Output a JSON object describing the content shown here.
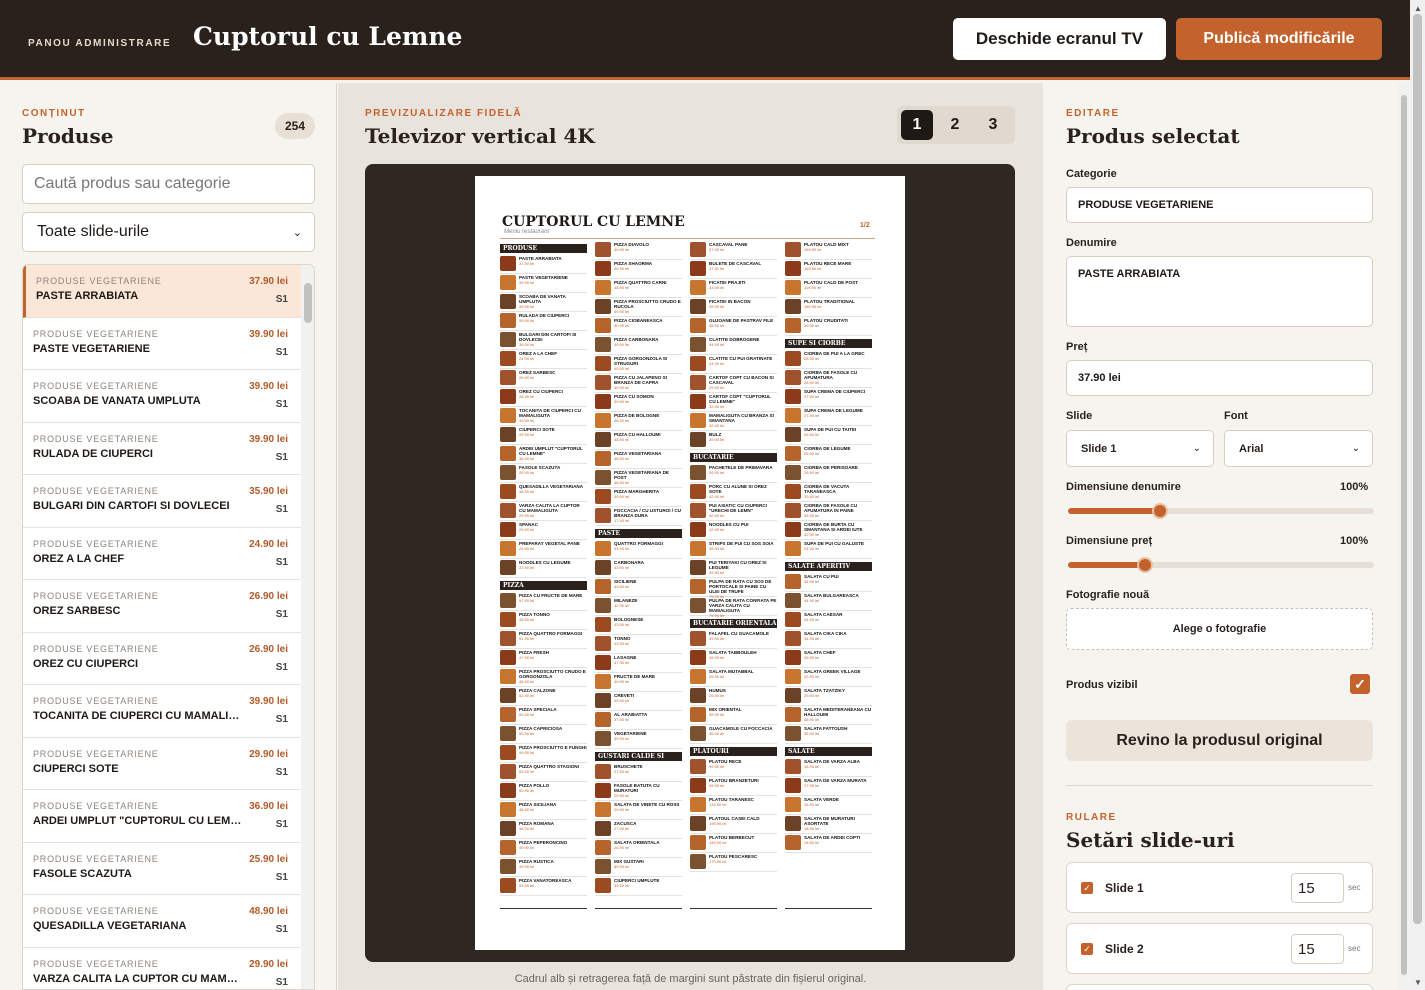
{
  "topbar": {
    "kicker": "PANOU ADMINISTRARE",
    "title": "Cuptorul cu Lemne",
    "tv_button": "Deschide ecranul TV",
    "publish_button": "Publică modificările"
  },
  "left": {
    "kicker": "CONȚINUT",
    "title": "Produse",
    "count": "254",
    "search_placeholder": "Caută produs sau categorie",
    "slide_filter": "Toate slide-urile",
    "items": [
      {
        "cat": "PRODUSE VEGETARIENE",
        "name": "PASTE ARRABIATA",
        "price": "37.90 lei",
        "slide": "S1",
        "active": true
      },
      {
        "cat": "PRODUSE VEGETARIENE",
        "name": "PASTE VEGETARIENE",
        "price": "39.90 lei",
        "slide": "S1"
      },
      {
        "cat": "PRODUSE VEGETARIENE",
        "name": "SCOABA DE VANATA UMPLUTA",
        "price": "39.90 lei",
        "slide": "S1"
      },
      {
        "cat": "PRODUSE VEGETARIENE",
        "name": "RULADA DE CIUPERCI",
        "price": "39.90 lei",
        "slide": "S1"
      },
      {
        "cat": "PRODUSE VEGETARIENE",
        "name": "BULGARI DIN CARTOFI SI DOVLECEI",
        "price": "35.90 lei",
        "slide": "S1"
      },
      {
        "cat": "PRODUSE VEGETARIENE",
        "name": "OREZ A LA CHEF",
        "price": "24.90 lei",
        "slide": "S1"
      },
      {
        "cat": "PRODUSE VEGETARIENE",
        "name": "OREZ SARBESC",
        "price": "26.90 lei",
        "slide": "S1"
      },
      {
        "cat": "PRODUSE VEGETARIENE",
        "name": "OREZ CU CIUPERCI",
        "price": "26.90 lei",
        "slide": "S1"
      },
      {
        "cat": "PRODUSE VEGETARIENE",
        "name": "TOCANITA DE CIUPERCI CU MAMALIGUTA",
        "price": "39.90 lei",
        "slide": "S1"
      },
      {
        "cat": "PRODUSE VEGETARIENE",
        "name": "CIUPERCI SOTE",
        "price": "29.90 lei",
        "slide": "S1"
      },
      {
        "cat": "PRODUSE VEGETARIENE",
        "name": "ARDEI UMPLUT \"CUPTORUL CU LEMNE\"",
        "price": "36.90 lei",
        "slide": "S1"
      },
      {
        "cat": "PRODUSE VEGETARIENE",
        "name": "FASOLE SCAZUTA",
        "price": "25.90 lei",
        "slide": "S1"
      },
      {
        "cat": "PRODUSE VEGETARIENE",
        "name": "QUESADILLA VEGETARIANA",
        "price": "48.90 lei",
        "slide": "S1"
      },
      {
        "cat": "PRODUSE VEGETARIENE",
        "name": "VARZA CALITA LA CUPTOR CU MAMALIGUTA",
        "price": "29.90 lei",
        "slide": "S1"
      }
    ]
  },
  "center": {
    "kicker": "PREVIZUALIZARE FIDELĂ",
    "title": "Televizor vertical 4K",
    "pages": [
      "1",
      "2",
      "3"
    ],
    "caption": "Cadrul alb și retragerea față de margini sunt păstrate din fișierul original.",
    "menu": {
      "title": "CUPTORUL CU LEMNE",
      "subtitle": "Meniu restaurant",
      "page": "1/2",
      "columns": [
        [
          {
            "type": "cat",
            "text": "PRODUSE VEGETARIENE"
          },
          {
            "n": "PASTE ARRABIATA",
            "p": "37.90 lei"
          },
          {
            "n": "PASTE VEGETARIENE",
            "p": "39.90 lei"
          },
          {
            "n": "SCOABA DE VANATA UMPLUTA",
            "p": "39.90 lei"
          },
          {
            "n": "RULADA DE CIUPERCI",
            "p": "39.90 lei"
          },
          {
            "n": "BULGARI DIN CARTOFI SI DOVLECEI",
            "p": "35.90 lei"
          },
          {
            "n": "OREZ A LA CHEF",
            "p": "24.90 lei"
          },
          {
            "n": "OREZ SARBESC",
            "p": "26.90 lei"
          },
          {
            "n": "OREZ CU CIUPERCI",
            "p": "26.90 lei"
          },
          {
            "n": "TOCANITA DE CIUPERCI CU MAMALIGUTA",
            "p": "39.90 lei"
          },
          {
            "n": "CIUPERCI SOTE",
            "p": "29.90 lei"
          },
          {
            "n": "ARDEI UMPLUT \"CUPTORUL CU LEMNE\"",
            "p": "36.90 lei"
          },
          {
            "n": "FASOLE SCAZUTA",
            "p": "25.90 lei"
          },
          {
            "n": "QUESADILLA VEGETARIANA",
            "p": "48.90 lei"
          },
          {
            "n": "VARZA CALITA LA CUPTOR CU MAMALIGUTA",
            "p": "29.90 lei"
          },
          {
            "n": "SPANAC",
            "p": "29.90 lei"
          },
          {
            "n": "PREPARAT VEGETAL PANE",
            "p": "29.90 lei"
          },
          {
            "n": "NOODLES CU LEGUME",
            "p": "37.90 lei"
          },
          {
            "type": "cat",
            "text": "PIZZA"
          },
          {
            "n": "PIZZA CU FRUCTE DE MARE",
            "p": "57.90 lei"
          },
          {
            "n": "PIZZA TONNO",
            "p": "48.90 lei"
          },
          {
            "n": "PIZZA QUATTRO FORMAGGI",
            "p": "51.90 lei"
          },
          {
            "n": "PIZZA FRESH",
            "p": "47.90 lei"
          },
          {
            "n": "PIZZA PROSCIUTTO CRUDO E GORGONZOLA",
            "p": "48.90 lei"
          },
          {
            "n": "PIZZA CALZONE",
            "p": "52.90 lei"
          },
          {
            "n": "PIZZA SPECIALA",
            "p": "52.90 lei"
          },
          {
            "n": "PIZZA CAPRICIOSA",
            "p": "50.90 lei"
          },
          {
            "n": "PIZZA PROSCIUTTO E FUNGHI",
            "p": "49.90 lei"
          },
          {
            "n": "PIZZA QUATTRO STAGIONI",
            "p": "53.90 lei"
          },
          {
            "n": "PIZZA POLLO",
            "p": "50.90 lei"
          },
          {
            "n": "PIZZA SICILIANA",
            "p": "48.90 lei"
          },
          {
            "n": "PIZZA ROMANA",
            "p": "48.90 lei"
          },
          {
            "n": "PIZZA PEPERONCINO",
            "p": "49.90 lei"
          },
          {
            "n": "PIZZA RUSTICA",
            "p": "49.90 lei"
          },
          {
            "n": "PIZZA VANATOREASCA",
            "p": "53.90 lei"
          }
        ],
        [
          {
            "n": "PIZZA DIAVOLO",
            "p": "49.90 lei"
          },
          {
            "n": "PIZZA SHAORMA",
            "p": "49.90 lei"
          },
          {
            "n": "PIZZA QUATTRO CARNI",
            "p": "48.90 lei"
          },
          {
            "n": "PIZZA PROSCIUTTO CRUDO E RUCOLA",
            "p": "49.90 lei"
          },
          {
            "n": "PIZZA CIOBANEASCA",
            "p": "50.90 lei"
          },
          {
            "n": "PIZZA CARBONARA",
            "p": "49.90 lei"
          },
          {
            "n": "PIZZA GORGONZOLA SI STRUGURI",
            "p": "49.90 lei"
          },
          {
            "n": "PIZZA CU JALAPENO SI BRANZA DE CAPRA",
            "p": "49.90 lei"
          },
          {
            "n": "PIZZA CU SOMON",
            "p": "59.90 lei"
          },
          {
            "n": "PIZZA DE BOLOGNE",
            "p": "48.90 lei"
          },
          {
            "n": "PIZZA CU HALLOUMI",
            "p": "48.90 lei"
          },
          {
            "n": "PIZZA VEGETARIANA",
            "p": "48.90 lei"
          },
          {
            "n": "PIZZA VEGETARIANA DE POST",
            "p": "48.90 lei"
          },
          {
            "n": "PIZZA MARGHERITA",
            "p": "39.90 lei"
          },
          {
            "n": "FOCCACIA / CU USTUROI / CU BRANZA DURA",
            "p": "17.90 lei"
          },
          {
            "type": "cat",
            "text": "PASTE"
          },
          {
            "n": "QUATTRO FORMAGGI",
            "p": "43.90 lei"
          },
          {
            "n": "CARBONARA",
            "p": "43.90 lei"
          },
          {
            "n": "SICILIENE",
            "p": "43.90 lei"
          },
          {
            "n": "MILANEZE",
            "p": "42.90 lei"
          },
          {
            "n": "BOLOGNESE",
            "p": "43.90 lei"
          },
          {
            "n": "TONNO",
            "p": "43.90 lei"
          },
          {
            "n": "LASAGNE",
            "p": "47.90 lei"
          },
          {
            "n": "FRUCTE DE MARE",
            "p": "49.90 lei"
          },
          {
            "n": "CREVETI",
            "p": "49.90 lei"
          },
          {
            "n": "AL ARABIATTA",
            "p": "37.90 lei"
          },
          {
            "n": "VEGETARIENE",
            "p": "39.90 lei"
          },
          {
            "type": "cat",
            "text": "GUSTARI CALDE SI RECI"
          },
          {
            "n": "BRUSCHETE",
            "p": "27.90 lei"
          },
          {
            "n": "FASOLE BATUTA CU MURATURI",
            "p": "29.90 lei"
          },
          {
            "n": "SALATA DE VINETE CU ROSII",
            "p": "29.90 lei"
          },
          {
            "n": "ZACUSCA",
            "p": "27.90 lei"
          },
          {
            "n": "SALATA ORIENTALA",
            "p": "26.90 lei"
          },
          {
            "n": "MIX GUSTARI",
            "p": "89.90 lei"
          },
          {
            "n": "CIUPERCI UMPLUTE",
            "p": "39.90 lei"
          }
        ],
        [
          {
            "n": "CASCAVAL PANE",
            "p": "37.90 lei"
          },
          {
            "n": "BULETE DE CASCAVAL",
            "p": "37.90 lei"
          },
          {
            "n": "FICATEI PRAJITI",
            "p": "33.90 lei"
          },
          {
            "n": "FICATEI IN BACON",
            "p": "39.90 lei"
          },
          {
            "n": "GUJOANE DE PASTRAV FILE",
            "p": "46.90 lei"
          },
          {
            "n": "CLATITE DOBROGENE",
            "p": "44.90 lei"
          },
          {
            "n": "CLATITE CU PUI GRATINATE",
            "p": "44.90 lei"
          },
          {
            "n": "CARTOF COPT CU BACON SI CASCAVAL",
            "p": "29.90 lei"
          },
          {
            "n": "CARTOF COPT \"CUPTORUL CU LEMNE\"",
            "p": "32.90 lei"
          },
          {
            "n": "MAMALIGUTA CU BRANZA SI SMANTANA",
            "p": "32.90 lei"
          },
          {
            "n": "BULZ",
            "p": "39.90 lei"
          },
          {
            "type": "cat",
            "text": "BUCATARIE INTERNATIONALA"
          },
          {
            "n": "PACHETELE DE PRIMAVARA",
            "p": "26.90 lei"
          },
          {
            "n": "PORC CU ALUNE SI OREZ SOTE",
            "p": "42.90 lei"
          },
          {
            "n": "PUI ASIATIC CU CIUPERCI \"URECHI DE LEMN\"",
            "p": "42.90 lei"
          },
          {
            "n": "NOODLES CU PUI",
            "p": "42.90 lei"
          },
          {
            "n": "STRIPS DE PUI CU SOS SOIA",
            "p": "39.90 lei"
          },
          {
            "n": "PUI TERIYAKI CU OREZ SI LEGUME",
            "p": "49.90 lei"
          },
          {
            "n": "PULPA DE RATA CU SOS DE PORTOCALE SI PAINE CU ULEI DE TRUFE",
            "p": "79.90 lei"
          },
          {
            "n": "PULPA DE RATA CONFIATA PE VARZA CALITA CU MAMALIGUTA",
            "p": "79.90 lei"
          },
          {
            "type": "cat",
            "text": "BUCATARIE ORIENTALA"
          },
          {
            "n": "FALAFEL CU GUACAMOLE",
            "p": "39.90 lei"
          },
          {
            "n": "SALATA TABBOULEH",
            "p": "26.90 lei"
          },
          {
            "n": "SALATA MUTABBAL",
            "p": "25.90 lei"
          },
          {
            "n": "HUMUS",
            "p": "25.90 lei"
          },
          {
            "n": "MIX ORIENTAL",
            "p": "59.90 lei"
          },
          {
            "n": "GUACAMOLE CU FOCCACIA",
            "p": "36.90 lei"
          },
          {
            "type": "cat",
            "text": "PLATOURI"
          },
          {
            "n": "PLATOU RECE",
            "p": "99.90 lei"
          },
          {
            "n": "PLATOU BRANZETURI",
            "p": "99.90 lei"
          },
          {
            "n": "PLATOU TARANESC",
            "p": "134.90 lei"
          },
          {
            "n": "PLATOUL CASEI CALD",
            "p": "199.90 lei"
          },
          {
            "n": "PLATOU BERBECUT",
            "p": "149.90 lei"
          },
          {
            "n": "PLATOU PESCARESC",
            "p": "179.90 lei"
          }
        ],
        [
          {
            "n": "PLATOU CALD MIXT",
            "p": "169.90 lei"
          },
          {
            "n": "PLATOU RECE MARE",
            "p": "169.90 lei"
          },
          {
            "n": "PLATOU CALD DE POST",
            "p": "119.90 lei"
          },
          {
            "n": "PLATOU TRADITIONAL",
            "p": "189.90 lei"
          },
          {
            "n": "PLATOU CRUDITATI",
            "p": "39.90 lei"
          },
          {
            "type": "cat",
            "text": "SUPE SI CIORBE"
          },
          {
            "n": "CIORBA DE PUI A LA GREC",
            "p": "28.90 lei"
          },
          {
            "n": "CIORBA DE FASOLE CU AFUMATURA",
            "p": "28.90 lei"
          },
          {
            "n": "SUPA CREMA DE CIUPERCI",
            "p": "27.90 lei"
          },
          {
            "n": "SUPA CREMA DE LEGUME",
            "p": "27.90 lei"
          },
          {
            "n": "SUPA DE PUI CU TAITEI",
            "p": "26.90 lei"
          },
          {
            "n": "CIORBA DE LEGUME",
            "p": "26.90 lei"
          },
          {
            "n": "CIORBA DE PERISOARE",
            "p": "28.90 lei"
          },
          {
            "n": "CIORBA DE VACUTA TARANEASCA",
            "p": "29.90 lei"
          },
          {
            "n": "CIORBA DE FASOLE CU AFUMATURA IN PAINE",
            "p": "35.90 lei"
          },
          {
            "n": "CIORBA DE BURTA CU SMANTANA SI ARDEI IUTE",
            "p": "32.90 lei"
          },
          {
            "n": "SUPA DE PUI CU GALUSTE",
            "p": "24.90 lei"
          },
          {
            "type": "cat",
            "text": "SALATE APERITIV"
          },
          {
            "n": "SALATA CU PUI",
            "p": "34.90 lei"
          },
          {
            "n": "SALATA BULGAREASCA",
            "p": "44.90 lei"
          },
          {
            "n": "SALATA CAESAR",
            "p": "44.90 lei"
          },
          {
            "n": "SALATA CIKA CIKA",
            "p": "34.90 lei"
          },
          {
            "n": "SALATA CHEF",
            "p": "45.90 lei"
          },
          {
            "n": "SALATA GREEK VILLAGE",
            "p": "42.90 lei"
          },
          {
            "n": "SALATA TZATZIKY",
            "p": "29.90 lei"
          },
          {
            "n": "SALATA MEDITERANEANA CU HALLOUMI",
            "p": "48.90 lei"
          },
          {
            "n": "SALATA FATTOUSH",
            "p": "35.90 lei"
          },
          {
            "type": "cat",
            "text": "SALATE"
          },
          {
            "n": "SALATA DE VARZA ALBA",
            "p": "15.90 lei"
          },
          {
            "n": "SALATA DE VARZA MURATA",
            "p": "17.90 lei"
          },
          {
            "n": "SALATA VERDE",
            "p": "15.90 lei"
          },
          {
            "n": "SALATA DE MURATURI ASORTATE",
            "p": "18.90 lei"
          },
          {
            "n": "SALATA DE ARDEI COPTI",
            "p": "18.90 lei"
          }
        ]
      ]
    }
  },
  "right": {
    "kicker": "EDITARE",
    "title": "Produs selectat",
    "category_label": "Categorie",
    "category_value": "PRODUSE VEGETARIENE",
    "name_label": "Denumire",
    "name_value": "PASTE ARRABIATA",
    "price_label": "Preț",
    "price_value": "37.90 lei",
    "slide_label": "Slide",
    "slide_value": "Slide 1",
    "font_label": "Font",
    "font_value": "Arial",
    "name_size_label": "Dimensiune denumire",
    "name_size_value": "100%",
    "name_size_level": 0.3,
    "price_size_label": "Dimensiune preț",
    "price_size_value": "100%",
    "price_size_level": 0.25,
    "photo_label": "Fotografie nouă",
    "photo_button": "Alege o fotografie",
    "visible_label": "Produs vizibil",
    "revert_button": "Revino la produsul original",
    "run_kicker": "RULARE",
    "run_title": "Setări slide-uri",
    "slides": [
      {
        "name": "Slide 1",
        "seconds": "15",
        "unit": "sec"
      },
      {
        "name": "Slide 2",
        "seconds": "15",
        "unit": "sec"
      }
    ]
  },
  "colors": {
    "accent": "#c4622d",
    "dark": "#2a211c",
    "bg": "#f6f4ef"
  }
}
